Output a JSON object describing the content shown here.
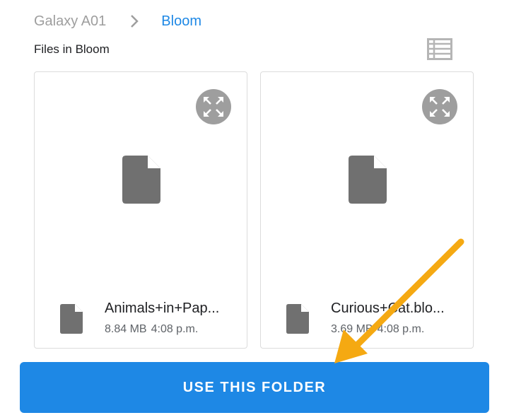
{
  "breadcrumb": {
    "root": "Galaxy A01",
    "current": "Bloom",
    "separator_icon": "chevron-right-icon"
  },
  "section": {
    "title": "Files in Bloom",
    "view_toggle_icon": "list-view-icon"
  },
  "files": [
    {
      "name": "Animals+in+Pap...",
      "size": "8.84 MB",
      "time": "4:08 p.m.",
      "icon": "file-icon"
    },
    {
      "name": "Curious+Cat.blo...",
      "size": "3.69 MB",
      "time": "4:08 p.m.",
      "icon": "file-icon"
    }
  ],
  "action": {
    "label": "USE THIS FOLDER"
  },
  "colors": {
    "accent": "#1e88e5",
    "icon_gray": "#707070",
    "annotation_arrow": "#f5a912"
  }
}
